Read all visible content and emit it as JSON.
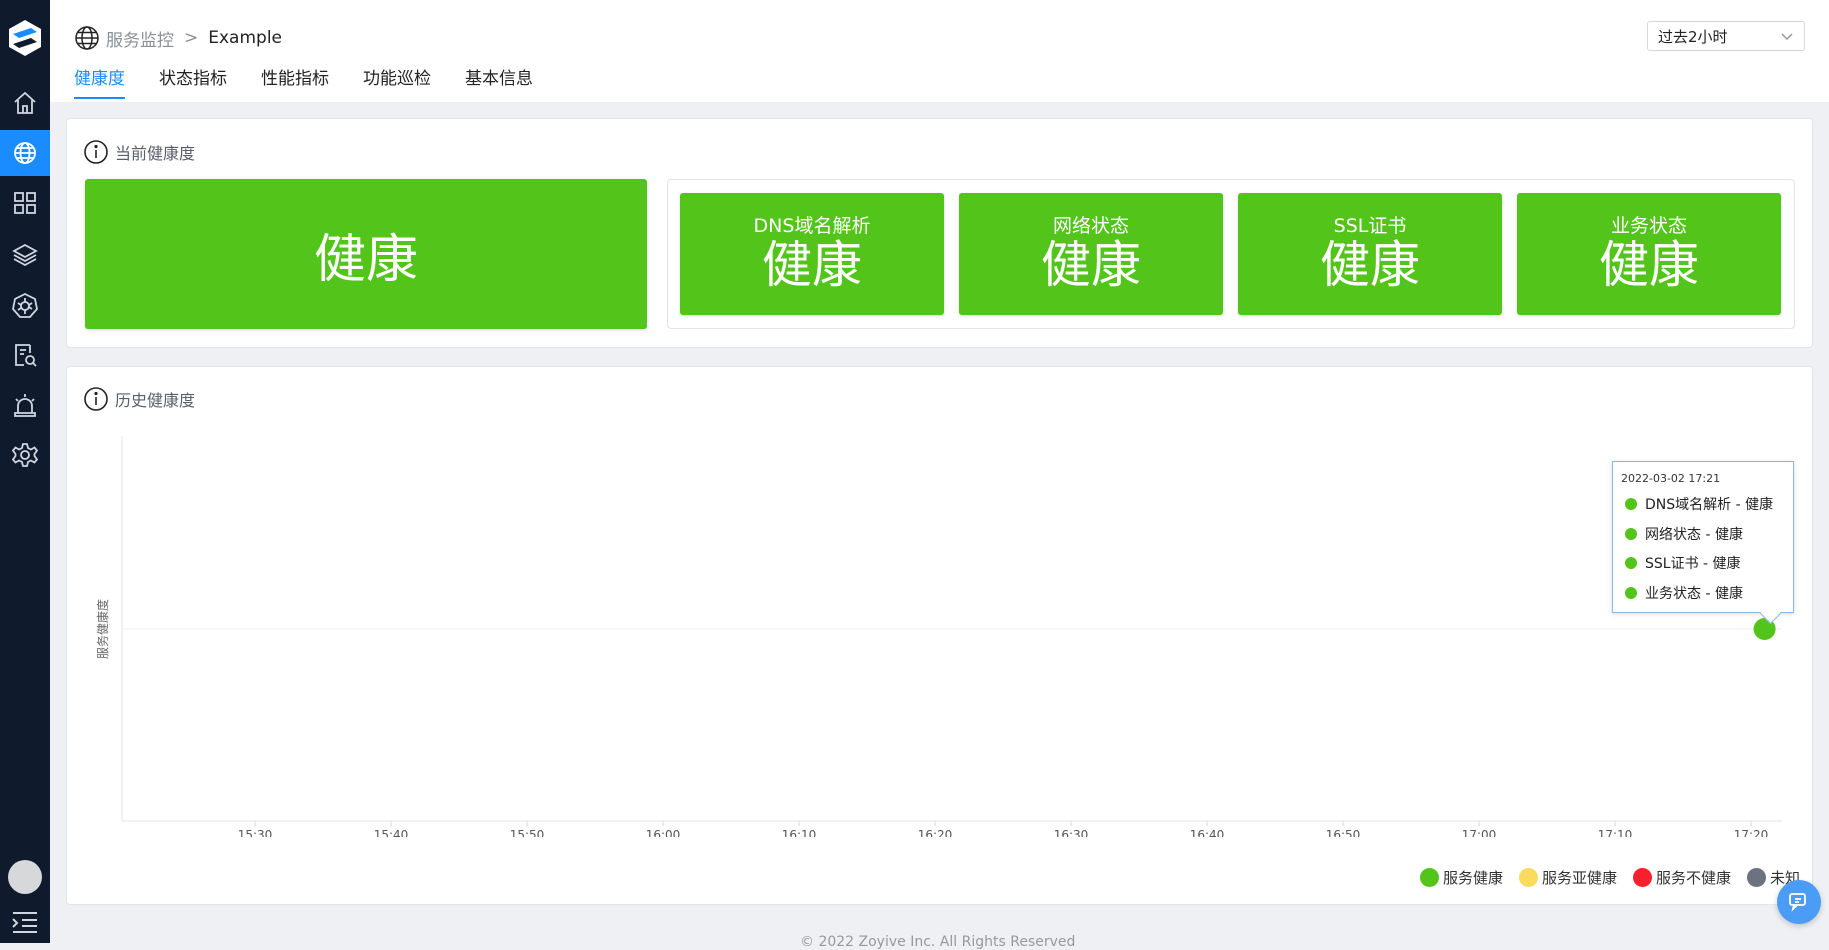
{
  "sidebar": {
    "items": [
      {
        "name": "home-icon",
        "active": false
      },
      {
        "name": "globe-icon",
        "active": true
      },
      {
        "name": "grid-icon",
        "active": false
      },
      {
        "name": "layers-icon",
        "active": false
      },
      {
        "name": "helm-icon",
        "active": false
      },
      {
        "name": "log-search-icon",
        "active": false
      },
      {
        "name": "alarm-icon",
        "active": false
      },
      {
        "name": "gear-icon",
        "active": false
      }
    ]
  },
  "breadcrumb": {
    "root": "服务监控",
    "separator": ">",
    "current": "Example"
  },
  "tabs": [
    {
      "label": "健康度",
      "active": true
    },
    {
      "label": "状态指标",
      "active": false
    },
    {
      "label": "性能指标",
      "active": false
    },
    {
      "label": "功能巡检",
      "active": false
    },
    {
      "label": "基本信息",
      "active": false
    }
  ],
  "time_range": {
    "value": "过去2小时"
  },
  "current_health": {
    "title": "当前健康度",
    "overall": "健康",
    "components": [
      {
        "label": "DNS域名解析",
        "status": "健康"
      },
      {
        "label": "网络状态",
        "status": "健康"
      },
      {
        "label": "SSL证书",
        "status": "健康"
      },
      {
        "label": "业务状态",
        "status": "健康"
      }
    ]
  },
  "history": {
    "title": "历史健康度",
    "tooltip": {
      "time": "2022-03-02 17:21",
      "rows": [
        "DNS域名解析 - 健康",
        "网络状态 - 健康",
        "SSL证书 - 健康",
        "业务状态 - 健康"
      ]
    }
  },
  "chart_data": {
    "type": "scatter",
    "ylabel": "服务健康度",
    "x_ticks": [
      "15:30",
      "15:40",
      "15:50",
      "16:00",
      "16:10",
      "16:20",
      "16:30",
      "16:40",
      "16:50",
      "17:00",
      "17:10",
      "17:20"
    ],
    "points": [
      {
        "x": "17:21",
        "status": "服务健康"
      }
    ],
    "legend": [
      {
        "label": "服务健康",
        "color": "#52c41a"
      },
      {
        "label": "服务亚健康",
        "color": "#fadb5c"
      },
      {
        "label": "服务不健康",
        "color": "#f5222d"
      },
      {
        "label": "未知",
        "color": "#6b7280"
      }
    ],
    "legend_position": "bottom-right"
  },
  "footer": {
    "text": "© 2022 Zoyive Inc. All Rights Reserved"
  },
  "colors": {
    "accent": "#1a8cff",
    "healthy": "#52c41a",
    "sidebar": "#0f1a2c"
  }
}
